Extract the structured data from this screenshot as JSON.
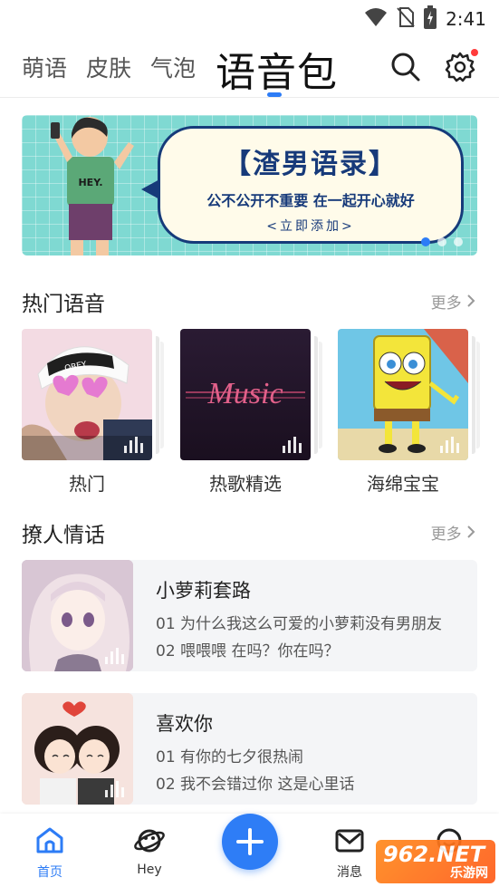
{
  "status_bar": {
    "time": "2:41",
    "icons": [
      "wifi-icon",
      "no-sim-icon",
      "battery-charging-icon"
    ]
  },
  "top_tabs": [
    {
      "label": "萌语",
      "active": false
    },
    {
      "label": "皮肤",
      "active": false
    },
    {
      "label": "气泡",
      "active": false
    },
    {
      "label": "语音包",
      "active": true
    }
  ],
  "header_icons": [
    "search-icon",
    "gear-icon"
  ],
  "banner": {
    "title": "【渣男语录】",
    "subtitle": "公不公开不重要 在一起开心就好",
    "cta": "<立即添加>",
    "shirt_text": "HEY."
  },
  "hot_section": {
    "title": "热门语音",
    "more": "更多",
    "items": [
      {
        "label": "热门",
        "art_text": "OBEY"
      },
      {
        "label": "热歌精选",
        "art_text": "Music"
      },
      {
        "label": "海绵宝宝",
        "art_text": ""
      }
    ]
  },
  "flirt_section": {
    "title": "撩人情话",
    "more": "更多",
    "items": [
      {
        "title": "小萝莉套路",
        "line1": "01 为什么我这么可爱的小萝莉没有男朋友",
        "line2": "02 喂喂喂 在吗？你在吗？"
      },
      {
        "title": "喜欢你",
        "line1": "01 有你的七夕很热闹",
        "line2": "02 我不会错过你 这是心里话"
      }
    ]
  },
  "bottom_nav": {
    "items": [
      {
        "label": "首页",
        "icon": "home-icon",
        "active": true
      },
      {
        "label": "Hey",
        "icon": "planet-icon",
        "active": false
      },
      {
        "label": "",
        "icon": "plus-icon",
        "active": false
      },
      {
        "label": "消息",
        "icon": "mail-icon",
        "active": false
      }
    ]
  },
  "watermark": {
    "top": "962.NET",
    "bottom": "乐游网"
  },
  "colors": {
    "accent": "#2d7cf6",
    "banner_bg": "#7fd9d2",
    "card_bg": "#f4f5f7",
    "badge_red": "#ff3b3b"
  }
}
